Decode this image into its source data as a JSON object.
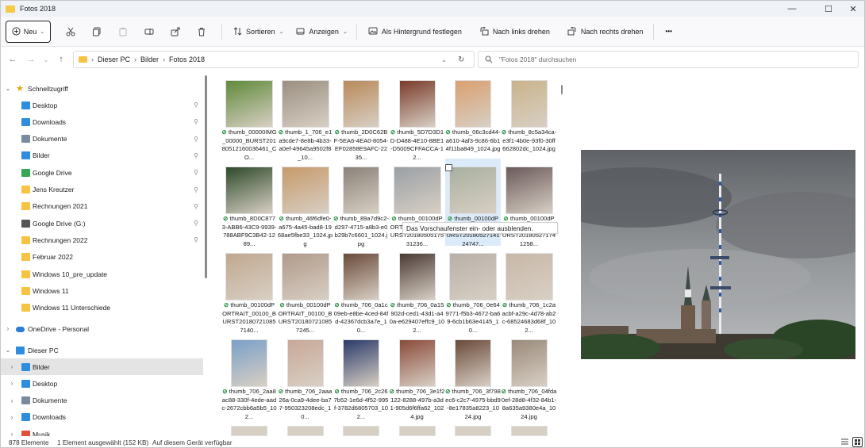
{
  "window": {
    "title": "Fotos 2018"
  },
  "window_controls": {
    "minimize": "—",
    "maximize": "☐",
    "close": "✕"
  },
  "toolbar": {
    "new_label": "Neu",
    "sort_label": "Sortieren",
    "view_label": "Anzeigen",
    "set_background_label": "Als Hintergrund festlegen",
    "rotate_left_label": "Nach links drehen",
    "rotate_right_label": "Nach rechts drehen",
    "more_label": "•••"
  },
  "address": {
    "crumbs": [
      "Dieser PC",
      "Bilder",
      "Fotos 2018"
    ],
    "separator": "›",
    "search_placeholder": "\"Fotos 2018\" durchsuchen"
  },
  "sidebar": {
    "quick_access": "Schnellzugriff",
    "pinned": [
      {
        "label": "Desktop",
        "icon": "desktop-icon"
      },
      {
        "label": "Downloads",
        "icon": "download-icon"
      },
      {
        "label": "Dokumente",
        "icon": "document-icon"
      },
      {
        "label": "Bilder",
        "icon": "pictures-icon"
      },
      {
        "label": "Google Drive",
        "icon": "google-drive-icon"
      },
      {
        "label": "Jens Kreutzer",
        "icon": "folder-icon"
      },
      {
        "label": "Rechnungen 2021",
        "icon": "folder-icon"
      },
      {
        "label": "Google Drive (G:)",
        "icon": "drive-icon"
      },
      {
        "label": "Rechnungen 2022",
        "icon": "folder-icon"
      },
      {
        "label": "Februar 2022",
        "icon": "folder-icon"
      },
      {
        "label": "Windows 10_pre_update",
        "icon": "folder-icon"
      },
      {
        "label": "Windows 11",
        "icon": "folder-icon"
      },
      {
        "label": "Windows 11 Unterschiede",
        "icon": "folder-icon"
      }
    ],
    "onedrive": "OneDrive - Personal",
    "this_pc": "Dieser PC",
    "pc_items": [
      {
        "label": "Bilder",
        "icon": "pictures-icon"
      },
      {
        "label": "Desktop",
        "icon": "desktop-icon"
      },
      {
        "label": "Dokumente",
        "icon": "document-icon"
      },
      {
        "label": "Downloads",
        "icon": "download-icon"
      },
      {
        "label": "Musik",
        "icon": "music-icon"
      }
    ]
  },
  "files": [
    {
      "name": "thumb_00000IMG_00000_BURST20180512160036461_CO...",
      "color": "#5f8a3a"
    },
    {
      "name": "thumb_1_706_e1a9cde7-8e8b-4b33-a0ef-49645a9502f8_10...",
      "color": "#9a8f80"
    },
    {
      "name": "thumb_2D0C62BF-5EA6-4EA0-8054-EF02858E9AFC-2235...",
      "color": "#b88a5a"
    },
    {
      "name": "thumb_5D7D3D1D-D488-4E10-8BE1-D5009CFFACCA-12...",
      "color": "#7a3a2a"
    },
    {
      "name": "thumb_06c3cd44-a610-4af3-9c86-6b14f11ba849_1024.jpg",
      "color": "#d9a070"
    },
    {
      "name": "thumb_8c5a34ca-e3f1-4b0e-93f0-30ff662802dc_1024.jpg",
      "color": "#c9b38a"
    },
    {
      "name": "thumb_8D0C8773-ABB6-43C9-9939-788ABF9C3B42-1289...",
      "color": "#2e4a2a"
    },
    {
      "name": "thumb_46f6dfe0-a675-4a45-bad8-1968ae5fbe33_1024.jpg",
      "color": "#c69a6a"
    },
    {
      "name": "thumb_89a7d9c2-d297-4715-a8b3-e0b29b7c6601_1024.jpg",
      "color": "#8a8278"
    },
    {
      "name": "thumb_00100dPORTRAIT_00100_BURST2018050517531236...",
      "color": "#9aa0a6"
    },
    {
      "name": "thumb_00100dPORTRAIT_00100_BURST2018052714124747...",
      "color": "#a8b0a0"
    },
    {
      "name": "thumb_00100dPORTRAIT_00100_BURST201805271741258...",
      "color": "#6a5a5a"
    },
    {
      "name": "thumb_00100dPORTRAIT_00100_BURST201807210857140...",
      "color": "#c0a890"
    },
    {
      "name": "thumb_00100dPORTRAIT_00100_BURST201807210857245...",
      "color": "#b09a8a"
    },
    {
      "name": "thumb_706_0a1c09eb-e8be-4ced-84fd-42367dcb3a7e_10...",
      "color": "#6a4a3a"
    },
    {
      "name": "thumb_706_0a15902d-ced1-43d1-a40a-e629407effc9_102...",
      "color": "#4a3a34"
    },
    {
      "name": "thumb_706_0e649771-f5b3-4672-ba69-6cb1b63e4145_10...",
      "color": "#b8b0a8"
    },
    {
      "name": "thumb_706_1c2aacbf-a29c-4d78-ab2c-68524683d68f_102...",
      "color": "#c8b8a8"
    },
    {
      "name": "thumb_706_2aa8ac88-330f-4ede-aadc-2672cbb6a5b5_102...",
      "color": "#7aa0c8"
    },
    {
      "name": "thumb_706_2aaa26a-0ca9-4dee-ba77-950323208edc_10...",
      "color": "#c8a898"
    },
    {
      "name": "thumb_706_2c267b52-1e6d-4f52-995f-3782d6805703_102...",
      "color": "#2a3a6a"
    },
    {
      "name": "thumb_706_3e1f2122-8288-497b-a3d1-905d6f6ffa62_1024.jpg",
      "color": "#8a4a3a"
    },
    {
      "name": "thumb_706_3f798ec6-c2c7-4975-bbd9-8e17835a8223_1024.jpg",
      "color": "#6a4a3a"
    },
    {
      "name": "thumb_706_04fda0ef-28d8-4f32-84b1-8a635a9380e4a_1024.jpg",
      "color": "#9a8a7a"
    }
  ],
  "tooltip": "Das Vorschaufenster ein- oder ausblenden.",
  "status": {
    "count": "878 Elemente",
    "selection": "1 Element ausgewählt (152 KB)",
    "availability": "Auf diesem Gerät verfügbar"
  }
}
